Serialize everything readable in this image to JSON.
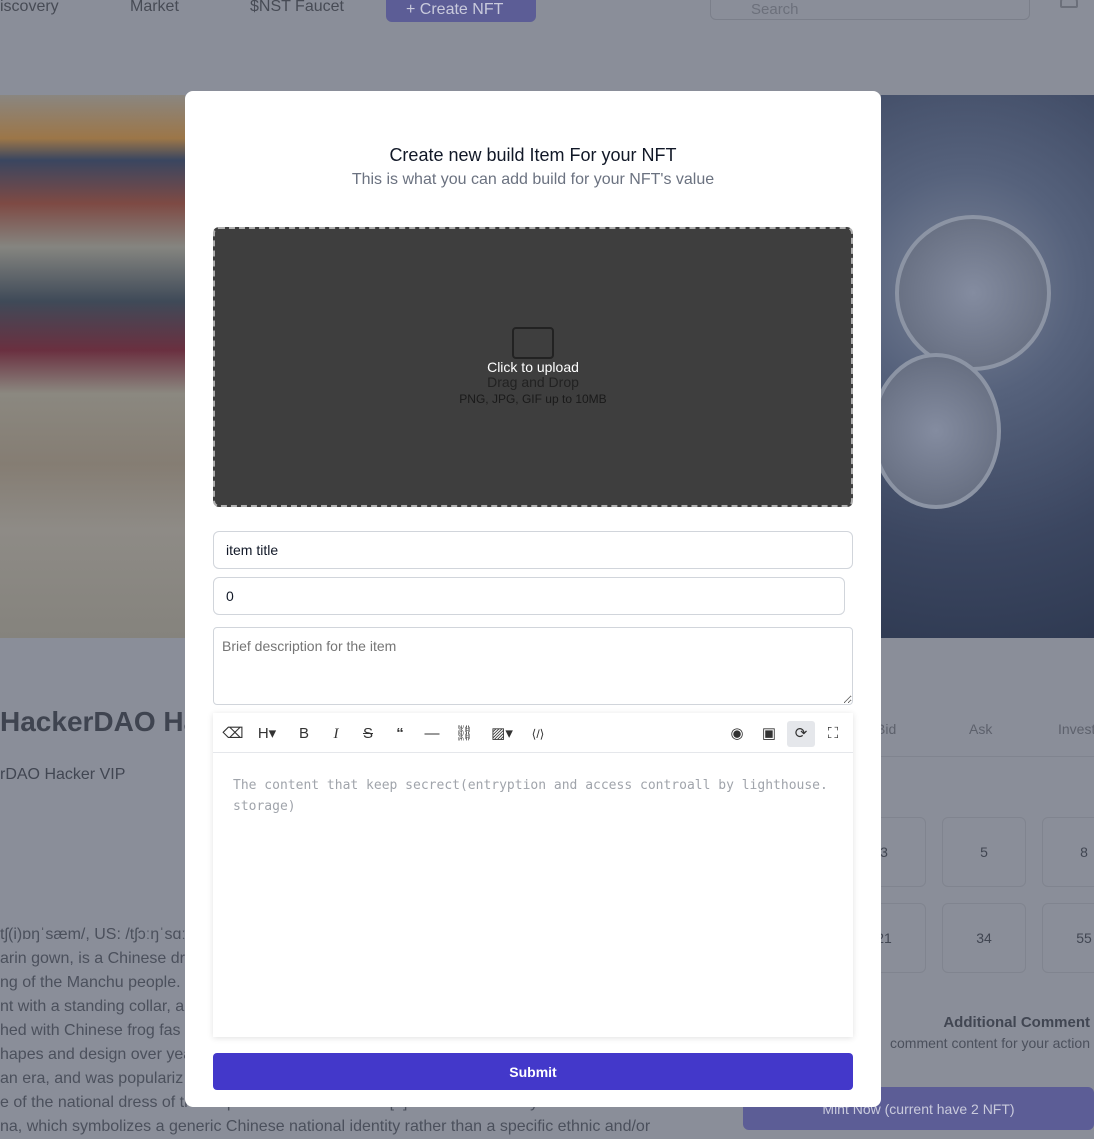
{
  "nav": {
    "items": [
      "iscovery",
      "Market",
      "$NST Faucet"
    ],
    "create_label": "+ Create NFT",
    "search_placeholder": "Search"
  },
  "page": {
    "title": "HackerDAO Ha",
    "subtitle": "rDAO Hacker VIP",
    "paragraph": [
      "tʃ(i)ɒŋˈsæm/, US: /tʃɔːŋˈsɑː",
      "arin gown, is a Chinese dr",
      "ng of the Manchu people.",
      "nt with a standing collar, a",
      "hed with Chinese frog fas",
      "hapes and design over yea",
      "an era, and was populariz",
      "e of the national dress of the Republic of China in 1929[6]. It and is currently the national",
      "na, which symbolizes a generic Chinese national identity rather than a specific ethnic and/or"
    ],
    "tabs": [
      "Bid",
      "Ask",
      "Invest"
    ],
    "grid": [
      "3",
      "5",
      "8",
      "21",
      "34",
      "55"
    ],
    "additional_comment": "Additional Comment",
    "comment_hint": "comment content for your action",
    "mint_label": "Mint Now (current have 2 NFT)"
  },
  "modal": {
    "title": "Create new build Item For your NFT",
    "subtitle": "This is what you can add build for your NFT's value",
    "upload": {
      "click": "Click to upload",
      "drag": "Drag and Drop",
      "hint": "PNG, JPG, GIF up to 10MB"
    },
    "item_title_value": "item title",
    "amount_value": "0",
    "description_placeholder": "Brief description for the item",
    "toolbar": [
      "eraser-icon",
      "heading-icon",
      "bold-icon",
      "italic-icon",
      "strikethrough-icon",
      "quote-icon",
      "horizontal-rule-icon",
      "link-icon",
      "image-icon",
      "code-icon",
      "preview-icon",
      "layout-icon",
      "sync-scroll-icon",
      "fullscreen-icon"
    ],
    "editor_placeholder": "The content that keep secrect(entryption and access controall by lighthouse.storage)",
    "submit_label": "Submit"
  },
  "colors": {
    "primary": "#4338ca",
    "overlay": "#8a8e99"
  }
}
